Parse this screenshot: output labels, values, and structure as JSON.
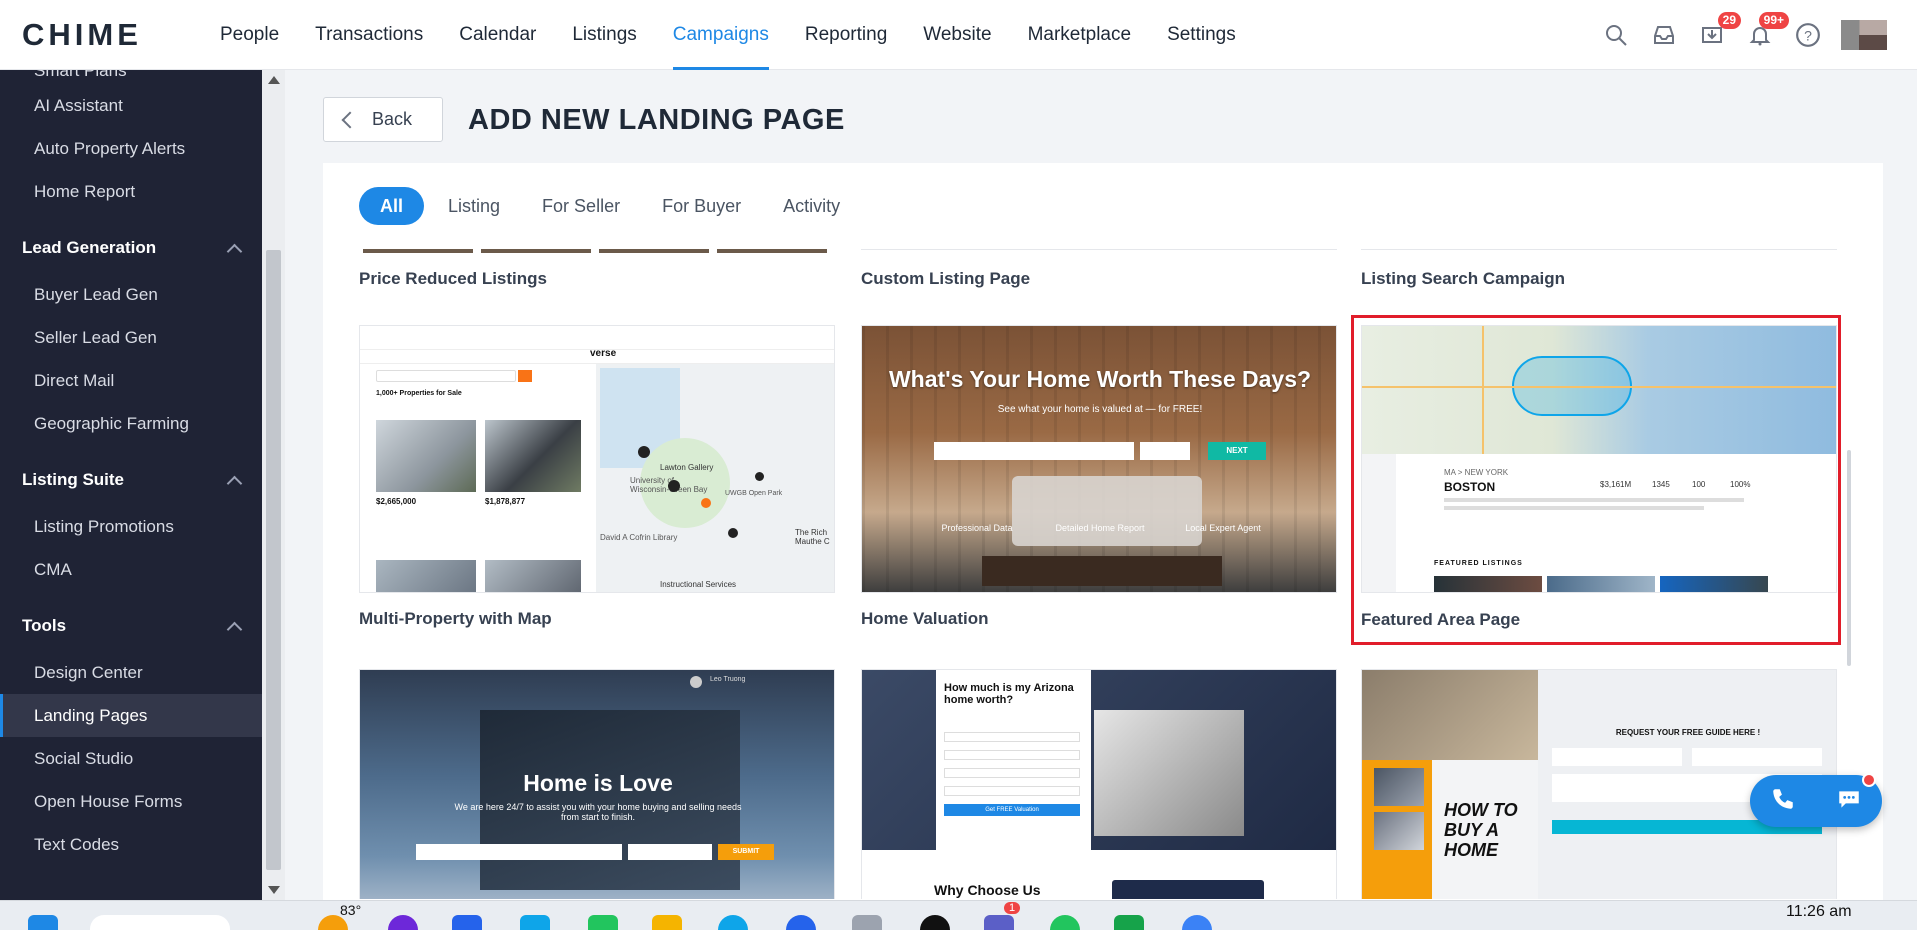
{
  "brand": {
    "logo": "CHIME"
  },
  "nav": {
    "links": [
      "People",
      "Transactions",
      "Calendar",
      "Listings",
      "Campaigns",
      "Reporting",
      "Website",
      "Marketplace",
      "Settings"
    ],
    "active": "Campaigns",
    "badges": {
      "notifications_a": "29",
      "notifications_b": "99+"
    }
  },
  "sidebar": {
    "cut_item": "Smart Plans",
    "top_items": [
      "AI Assistant",
      "Auto Property Alerts",
      "Home Report"
    ],
    "sections": [
      {
        "title": "Lead Generation",
        "items": [
          "Buyer Lead Gen",
          "Seller Lead Gen",
          "Direct Mail",
          "Geographic Farming"
        ]
      },
      {
        "title": "Listing Suite",
        "items": [
          "Listing Promotions",
          "CMA"
        ]
      },
      {
        "title": "Tools",
        "items": [
          "Design Center",
          "Landing Pages",
          "Social Studio",
          "Open House Forms",
          "Text Codes"
        ]
      }
    ],
    "active_item": "Landing Pages"
  },
  "page": {
    "back_label": "Back",
    "title": "ADD NEW LANDING PAGE",
    "tabs": [
      "All",
      "Listing",
      "For Seller",
      "For Buyer",
      "Activity"
    ],
    "active_tab": "All"
  },
  "cards_top_row": [
    "Price Reduced Listings",
    "Custom Listing Page",
    "Listing Search Campaign"
  ],
  "cards_middle_row": [
    "Multi-Property with Map",
    "Home Valuation",
    "Featured Area Page"
  ],
  "selected_card": "Featured Area Page",
  "thumb_text": {
    "valuation_headline": "What's Your Home Worth These Days?",
    "valuation_sub": "See what your home is valued at — for FREE!",
    "valuation_next": "NEXT",
    "valuation_features": [
      "Professional Data",
      "Detailed Home Report",
      "Local Expert Agent"
    ],
    "map_brand": "verse",
    "map_count": "1,000+ Properties for Sale",
    "map_prices": [
      "$2,665,000",
      "$1,878,877"
    ],
    "map_pois": [
      "Lawton Gallery",
      "University of Wisconsin-Green Bay",
      "UWGB Open Park",
      "David A Cofrin Library",
      "Instructional Services",
      "The Rich Mauthe C"
    ],
    "boston_city": "BOSTON",
    "boston_region": "MA > NEW YORK",
    "boston_stats": [
      "$3,161M",
      "1345",
      "100",
      "100%"
    ],
    "boston_featured": "FEATURED LISTINGS",
    "house_headline": "Home is Love",
    "house_sub": "We are here 24/7 to assist you with your home buying and selling needs from start to finish.",
    "house_submit": "SUBMIT",
    "house_agent": "Leo Truong",
    "az_headline": "How much is my Arizona home worth?",
    "az_cta": "Get FREE Valuation",
    "az_why": "Why Choose Us",
    "guide_headline": "REQUEST YOUR FREE GUIDE HERE !",
    "guide_book": "HOW TO BUY A HOME"
  },
  "taskbar": {
    "temperature": "83°",
    "clock": "11:26 am",
    "teams_badge": "1"
  },
  "colors": {
    "accent": "#1e88e5",
    "sidebar_bg": "#1f2335",
    "selection": "#e11d2a",
    "badge": "#ef4444"
  }
}
